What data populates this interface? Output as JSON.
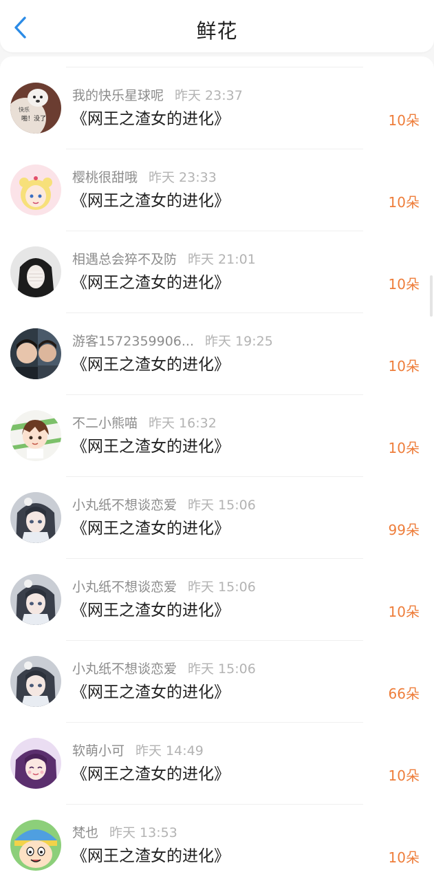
{
  "header": {
    "title": "鲜花",
    "back_icon": "chevron-left-icon",
    "accent_color": "#2b8be6"
  },
  "flower_color": "#ee7d3a",
  "items": [
    {
      "name": "我的快乐星球呢",
      "time": "昨天 23:37",
      "book": "《网王之渣女的进化》",
      "count": "10朵",
      "avatar_text": "快乐 啪！没了"
    },
    {
      "name": "樱桃很甜哦",
      "time": "昨天 23:33",
      "book": "《网王之渣女的进化》",
      "count": "10朵"
    },
    {
      "name": "相遇总会猝不及防",
      "time": "昨天 21:01",
      "book": "《网王之渣女的进化》",
      "count": "10朵"
    },
    {
      "name": "游客1572359906...",
      "time": "昨天 19:25",
      "book": "《网王之渣女的进化》",
      "count": "10朵"
    },
    {
      "name": "不二小熊喵",
      "time": "昨天 16:32",
      "book": "《网王之渣女的进化》",
      "count": "10朵"
    },
    {
      "name": "小丸纸不想谈恋爱",
      "time": "昨天 15:06",
      "book": "《网王之渣女的进化》",
      "count": "99朵"
    },
    {
      "name": "小丸纸不想谈恋爱",
      "time": "昨天 15:06",
      "book": "《网王之渣女的进化》",
      "count": "10朵"
    },
    {
      "name": "小丸纸不想谈恋爱",
      "time": "昨天 15:06",
      "book": "《网王之渣女的进化》",
      "count": "66朵"
    },
    {
      "name": "软萌小可",
      "time": "昨天 14:49",
      "book": "《网王之渣女的进化》",
      "count": "10朵"
    },
    {
      "name": "梵也",
      "time": "昨天 13:53",
      "book": "《网王之渣女的进化》",
      "count": "10朵"
    }
  ]
}
